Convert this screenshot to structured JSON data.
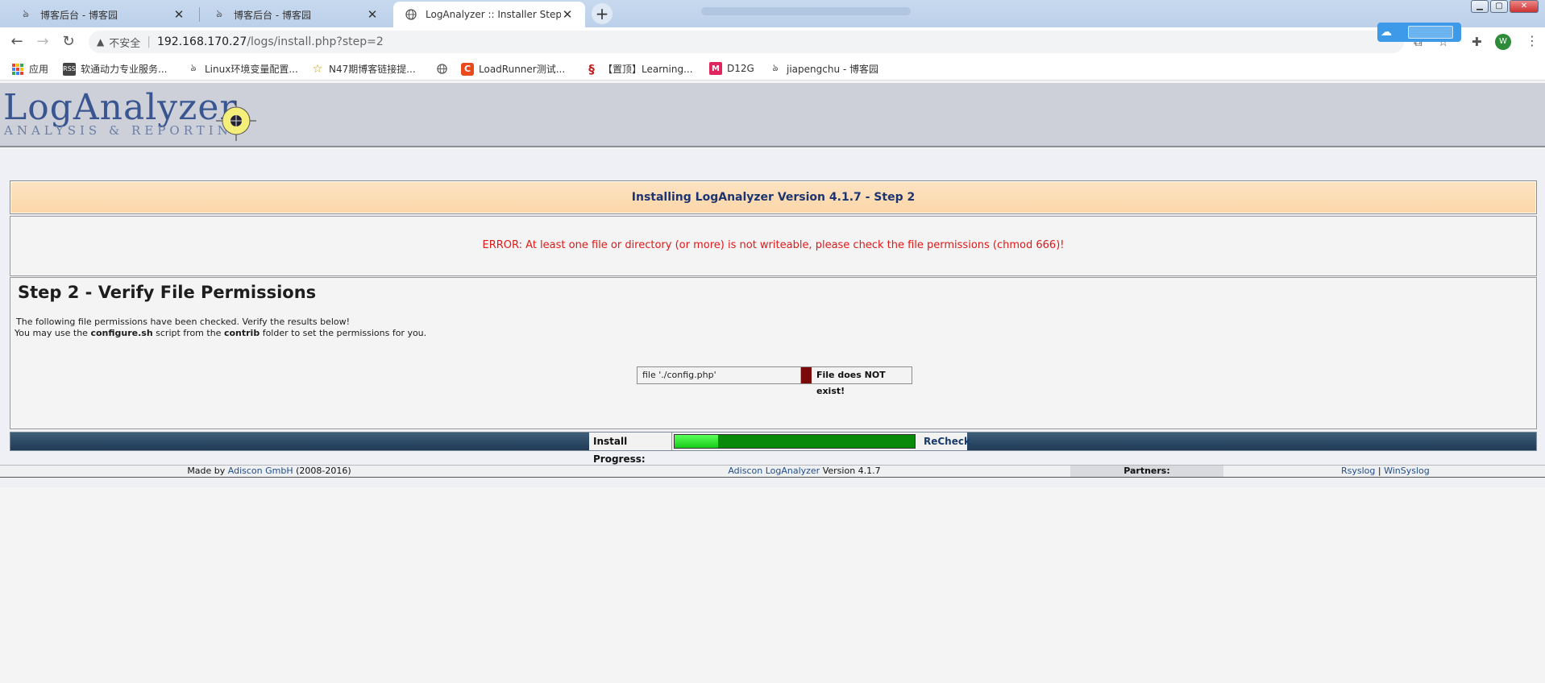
{
  "browser": {
    "tabs": [
      {
        "label": "博客后台 - 博客园",
        "icon": "cnblogs-icon",
        "active": false
      },
      {
        "label": "博客后台 - 博客园",
        "icon": "cnblogs-icon",
        "active": false
      },
      {
        "label": "LogAnalyzer :: Installer Step 2",
        "icon": "globe-icon",
        "active": true
      }
    ],
    "address": {
      "security_label": "不安全",
      "host": "192.168.170.27",
      "path": "/logs/install.php?step=2"
    },
    "avatar_letter": "W",
    "bookmarks": [
      {
        "label": "应用",
        "icon": "apps-grid-icon"
      },
      {
        "label": "软通动力专业服务...",
        "icon": "rss-icon"
      },
      {
        "label": "Linux环境变量配置...",
        "icon": "cnblogs-icon"
      },
      {
        "label": "N47期博客链接提...",
        "icon": "star-icon"
      },
      {
        "label": "",
        "icon": "globe-icon"
      },
      {
        "label": "LoadRunner测试...",
        "icon": "csdn-icon"
      },
      {
        "label": "【置顶】Learning...",
        "icon": "swirl-icon"
      },
      {
        "label": "D12G",
        "icon": "mail-icon"
      },
      {
        "label": "jiapengchu - 博客园",
        "icon": "cnblogs-icon"
      }
    ]
  },
  "logo": {
    "main": "LogAnalyzer",
    "sub": "ANALYSIS & REPORTING"
  },
  "installer": {
    "title": "Installing LogAnalyzer Version 4.1.7 - Step 2",
    "error": "ERROR: At least one file or directory (or more) is not writeable, please check the file permissions (chmod 666)!",
    "heading": "Step 2 - Verify File Permissions",
    "para1": "The following file permissions have been checked. Verify the results below!",
    "para2_pre": "You may use the ",
    "para2_script": "configure.sh",
    "para2_mid": " script from the ",
    "para2_folder": "contrib",
    "para2_post": " folder to set the permissions for you.",
    "check_file": "file './config.php'",
    "check_status": "File does NOT exist!",
    "status_color": "#7a0a0a"
  },
  "progress": {
    "label": "Install Progress:",
    "fraction": 0.18,
    "recheck_label": "ReCheck"
  },
  "footer": {
    "made_by_pre": "Made by ",
    "made_by_link": "Adiscon GmbH",
    "made_by_post": " (2008-2016)",
    "product_link": "Adiscon LogAnalyzer",
    "product_post": " Version 4.1.7",
    "partners_label": "Partners:",
    "partner1": "Rsyslog",
    "partner_sep": "|",
    "partner2": "WinSyslog"
  }
}
